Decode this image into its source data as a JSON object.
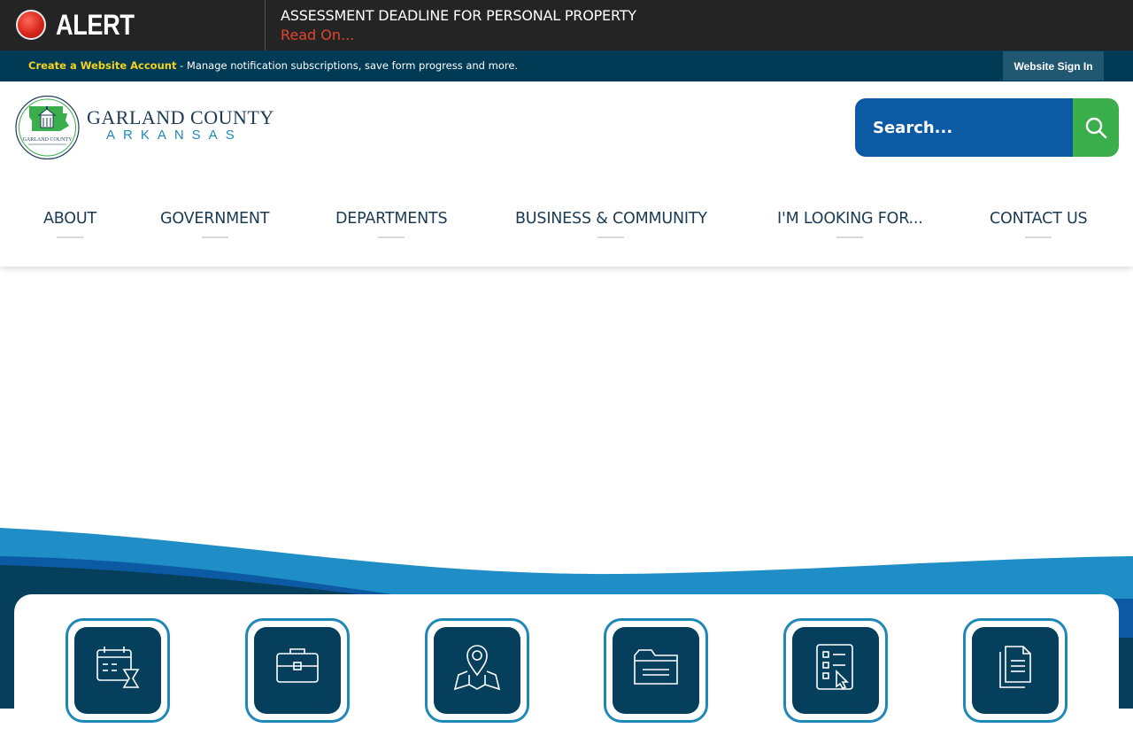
{
  "alert": {
    "label": "ALERT",
    "title": "ASSESSMENT DEADLINE FOR PERSONAL PROPERTY",
    "link": "Read On..."
  },
  "account_bar": {
    "link": "Create a Website Account",
    "text": " - Manage notification subscriptions, save form progress and more.",
    "signin": "Website Sign In"
  },
  "logo": {
    "name": "GARLAND COUNTY",
    "state": "ARKANSAS",
    "seal_text": "GARLAND COUNTY"
  },
  "search": {
    "placeholder": "Search..."
  },
  "nav": {
    "items": [
      "ABOUT",
      "GOVERNMENT",
      "DEPARTMENTS",
      "BUSINESS & COMMUNITY",
      "I'M LOOKING FOR...",
      "CONTACT US"
    ]
  },
  "quick_links": {
    "icons": [
      "calendar-icon",
      "briefcase-icon",
      "map-pin-icon",
      "folder-icon",
      "checklist-icon",
      "documents-icon"
    ]
  },
  "colors": {
    "alert_bg": "#242424",
    "account_bg": "#003a55",
    "accent_yellow": "#f5d31d",
    "nav_text": "#1b3b55",
    "search_blue": "#0c5aa3",
    "search_green": "#3aae4a",
    "tile_dark": "#063f5c",
    "tile_border": "#1f88b6"
  }
}
